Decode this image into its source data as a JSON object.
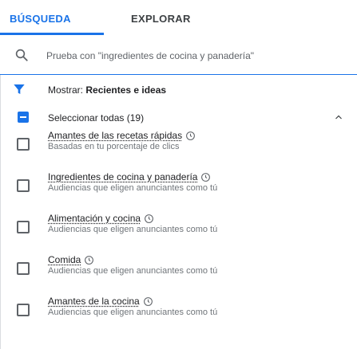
{
  "tabs": [
    {
      "label": "BÚSQUEDA",
      "active": true
    },
    {
      "label": "EXPLORAR",
      "active": false
    }
  ],
  "search": {
    "placeholder": "Prueba con \"ingredientes de cocina y panadería\"",
    "icon": "search-icon"
  },
  "filter": {
    "prefix": "Mostrar:",
    "value": "Recientes e ideas",
    "icon": "funnel-icon"
  },
  "select_all": {
    "label": "Seleccionar todas (19)",
    "state": "indeterminate"
  },
  "items": [
    {
      "title": "Amantes de las recetas rápidas",
      "subtitle": "Basadas en tu porcentaje de clics"
    },
    {
      "title": "Ingredientes de cocina y panadería",
      "subtitle": "Audiencias que eligen anunciantes como tú"
    },
    {
      "title": "Alimentación y cocina",
      "subtitle": "Audiencias que eligen anunciantes como tú"
    },
    {
      "title": "Comida",
      "subtitle": "Audiencias que eligen anunciantes como tú"
    },
    {
      "title": "Amantes de la cocina",
      "subtitle": "Audiencias que eligen anunciantes como tú"
    }
  ],
  "colors": {
    "accent": "#1a73e8",
    "text": "#202124",
    "secondary_text": "#70757a"
  }
}
